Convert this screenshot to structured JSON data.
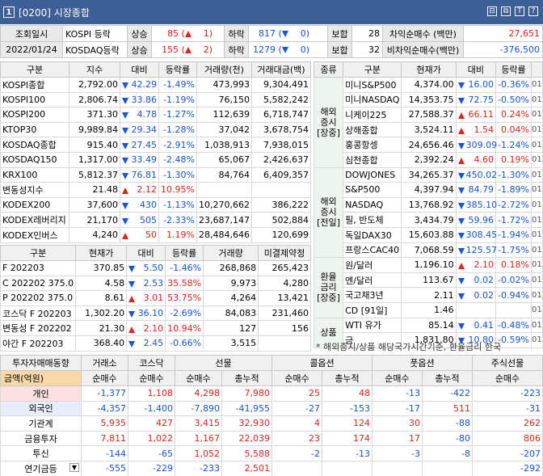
{
  "window": {
    "num": "1",
    "title": "[0200] 시장종합"
  },
  "top": {
    "row1": {
      "label": "조회일시",
      "idx": "KOSPI 등락",
      "up_label": "상승",
      "up_val": "85",
      "up2": "1",
      "down_label": "하락",
      "down_val": "817",
      "down2": "0",
      "flat_label": "보합",
      "flat_val": "28",
      "net_label": "차익순매수 (백만)",
      "net_val": "27,651"
    },
    "row2": {
      "date": "2022/01/24",
      "idx": "KOSDAQ등락",
      "up_label": "상승",
      "up_val": "155",
      "up2": "2",
      "down_label": "하락",
      "down_val": "1279",
      "down2": "0",
      "flat_label": "보합",
      "flat_val": "32",
      "net_label": "비차익순매수(백만)",
      "net_val": "-376,500"
    }
  },
  "indices": {
    "headers": [
      "구분",
      "지수",
      "대비",
      "등락률",
      "거래량(천)",
      "거래대금(백)"
    ],
    "rows": [
      {
        "name": "KOSPI종합",
        "val": "2,792.00",
        "dir": "dn",
        "chg": "42.29",
        "pct": "-1.49%",
        "vol": "473,993",
        "amt": "9,304,491"
      },
      {
        "name": "KOSPI100",
        "val": "2,806.74",
        "dir": "dn",
        "chg": "33.86",
        "pct": "-1.19%",
        "vol": "76,150",
        "amt": "5,582,242"
      },
      {
        "name": "KOSPI200",
        "val": "371.30",
        "dir": "dn",
        "chg": "4.78",
        "pct": "-1.27%",
        "vol": "112,639",
        "amt": "6,718,747"
      },
      {
        "name": "KTOP30",
        "val": "9,989.84",
        "dir": "dn",
        "chg": "29.34",
        "pct": "-1.28%",
        "vol": "37,042",
        "amt": "3,678,754"
      },
      {
        "name": "KOSDAQ종합",
        "val": "915.40",
        "dir": "dn",
        "chg": "27.45",
        "pct": "-2.91%",
        "vol": "1,038,913",
        "amt": "7,938,015"
      },
      {
        "name": "KOSDAQ150",
        "val": "1,317.00",
        "dir": "dn",
        "chg": "33.49",
        "pct": "-2.48%",
        "vol": "65,067",
        "amt": "2,426,637"
      },
      {
        "name": "KRX100",
        "val": "5,812.37",
        "dir": "dn",
        "chg": "76.81",
        "pct": "-1.30%",
        "vol": "84,764",
        "amt": "6,409,357"
      },
      {
        "name": "변동성지수",
        "val": "21.48",
        "dir": "up",
        "chg": "2.12",
        "pct": "10.95%",
        "vol": "",
        "amt": ""
      },
      {
        "name": "KODEX200",
        "val": "37,600",
        "dir": "dn",
        "chg": "430",
        "pct": "-1.13%",
        "vol": "10,270,662",
        "amt": "386,222"
      },
      {
        "name": "KODEX레버리지",
        "val": "21,170",
        "dir": "dn",
        "chg": "505",
        "pct": "-2.33%",
        "vol": "23,687,147",
        "amt": "502,884"
      },
      {
        "name": "KODEX인버스",
        "val": "4,240",
        "dir": "up",
        "chg": "50",
        "pct": "1.19%",
        "vol": "28,484,646",
        "amt": "120,699"
      }
    ]
  },
  "futures": {
    "headers": [
      "구분",
      "현재가",
      "대비",
      "등락률",
      "거래량",
      "미결제약정"
    ],
    "rows": [
      {
        "name": "F 202203",
        "val": "370.85",
        "dir": "dn",
        "chg": "5.50",
        "pct": "-1.46%",
        "vol": "268,868",
        "oi": "265,423"
      },
      {
        "name": "C 202202 375.0",
        "val": "4.58",
        "dir": "dn",
        "chg": "2.53",
        "pct": "35.58%",
        "vol": "9,973",
        "oi": "4,280"
      },
      {
        "name": "P 202202 375.0",
        "val": "8.61",
        "dir": "up",
        "chg": "3.01",
        "pct": "53.75%",
        "vol": "4,264",
        "oi": "13,421"
      },
      {
        "name": "코스닥 F 202203",
        "val": "1,302.20",
        "dir": "dn",
        "chg": "36.10",
        "pct": "-2.69%",
        "vol": "84,083",
        "oi": "231,460"
      },
      {
        "name": "변동성 F 202202",
        "val": "21.30",
        "dir": "up",
        "chg": "2.10",
        "pct": "10.94%",
        "vol": "127",
        "oi": "156"
      },
      {
        "name": "야간 F 202203",
        "val": "368.40",
        "dir": "dn",
        "chg": "2.45",
        "pct": "-0.66%",
        "vol": "3,515",
        "oi": ""
      }
    ]
  },
  "global": {
    "headers": [
      "종류",
      "구분",
      "현재가",
      "대비",
      "등락률"
    ],
    "groups": [
      {
        "label": "해외\n증시\n[장중]",
        "rows": [
          {
            "name": "미니S&P500",
            "val": "4,374.00",
            "dir": "dn",
            "chg": "16.00",
            "pct": "-0.36%"
          },
          {
            "name": "미니NASDAQ",
            "val": "14,353.75",
            "dir": "dn",
            "chg": "72.75",
            "pct": "-0.50%"
          },
          {
            "name": "니케이225",
            "val": "27,588.37",
            "dir": "up",
            "chg": "66.11",
            "pct": "0.24%"
          },
          {
            "name": "상해종합",
            "val": "3,524.11",
            "dir": "up",
            "chg": "1.54",
            "pct": "0.04%"
          },
          {
            "name": "홍콩항셍",
            "val": "24,656.46",
            "dir": "dn",
            "chg": "309.09",
            "pct": "-1.24%"
          },
          {
            "name": "심천종합",
            "val": "2,392.24",
            "dir": "up",
            "chg": "4.60",
            "pct": "0.19%"
          }
        ]
      },
      {
        "label": "해외\n증시\n[전일]",
        "rows": [
          {
            "name": "DOWJONES",
            "val": "34,265.37",
            "dir": "dn",
            "chg": "450.02",
            "pct": "-1.30%"
          },
          {
            "name": "S&P500",
            "val": "4,397.94",
            "dir": "dn",
            "chg": "84.79",
            "pct": "-1.89%"
          },
          {
            "name": "NASDAQ",
            "val": "13,768.92",
            "dir": "dn",
            "chg": "385.10",
            "pct": "-2.72%"
          },
          {
            "name": "필, 반도체",
            "val": "3,434.79",
            "dir": "dn",
            "chg": "59.96",
            "pct": "-1.72%"
          },
          {
            "name": "독일DAX30",
            "val": "15,603.88",
            "dir": "dn",
            "chg": "308.45",
            "pct": "-1.94%"
          },
          {
            "name": "프랑스CAC40",
            "val": "7,068.59",
            "dir": "dn",
            "chg": "125.57",
            "pct": "-1.75%"
          }
        ]
      },
      {
        "label": "환율\n금리\n[장중]",
        "rows": [
          {
            "name": "원/달러",
            "val": "1,196.10",
            "dir": "up",
            "chg": "2.10",
            "pct": "0.18%"
          },
          {
            "name": "엔/달러",
            "val": "113.67",
            "dir": "dn",
            "chg": "0.02",
            "pct": "-0.02%"
          },
          {
            "name": "국고채3년",
            "val": "2.11",
            "dir": "dn",
            "chg": "0.02",
            "pct": "-0.94%"
          },
          {
            "name": "CD [91일]",
            "val": "1.46",
            "dir": "",
            "chg": "",
            "pct": ""
          }
        ]
      },
      {
        "label": "상품",
        "rows": [
          {
            "name": "WTI 유가",
            "val": "85.14",
            "dir": "dn",
            "chg": "0.41",
            "pct": "-0.48%"
          },
          {
            "name": "금",
            "val": "1,831.80",
            "dir": "dn",
            "chg": "10.80",
            "pct": "-0.59%"
          }
        ]
      }
    ],
    "edge": "01"
  },
  "note": "* 해외증시/상품 해당국가시간기준, 환율금리 한국",
  "investors": {
    "h1": [
      "투자자매매동향",
      "거래소",
      "코스닥",
      "선물",
      "콜옵션",
      "풋옵션",
      "주식선물"
    ],
    "h2": [
      "금액(억원)",
      "순매수",
      "순매수",
      "순매수",
      "총누적",
      "순매수",
      "총누적",
      "순매수",
      "총누적",
      "순매수"
    ],
    "rows": [
      {
        "name": "개인",
        "c": [
          "-1,377",
          "1,108",
          "4,298",
          "7,980",
          "25",
          "48",
          "-13",
          "-422",
          "-223"
        ]
      },
      {
        "name": "외국인",
        "c": [
          "-4,357",
          "-1,400",
          "-7,890",
          "-41,955",
          "-27",
          "-153",
          "-17",
          "511",
          "-31"
        ]
      },
      {
        "name": "기관계",
        "c": [
          "5,935",
          "427",
          "3,415",
          "32,930",
          "4",
          "124",
          "30",
          "-88",
          "262"
        ]
      },
      {
        "name": "금융투자",
        "c": [
          "7,811",
          "1,022",
          "1,167",
          "22,039",
          "23",
          "174",
          "17",
          "-80",
          "806"
        ]
      },
      {
        "name": "투신",
        "c": [
          "-144",
          "-65",
          "1,052",
          "5,588",
          "-2",
          "-13",
          "-3",
          "-8",
          "-207"
        ]
      },
      {
        "name": "연기금등",
        "c": [
          "-555",
          "-229",
          "-233",
          "2,501",
          "",
          "",
          "",
          "",
          "-292"
        ]
      }
    ]
  },
  "colors": {
    "title_bg": "#3e5f95",
    "up": "#e2231a",
    "down": "#1555d6"
  }
}
